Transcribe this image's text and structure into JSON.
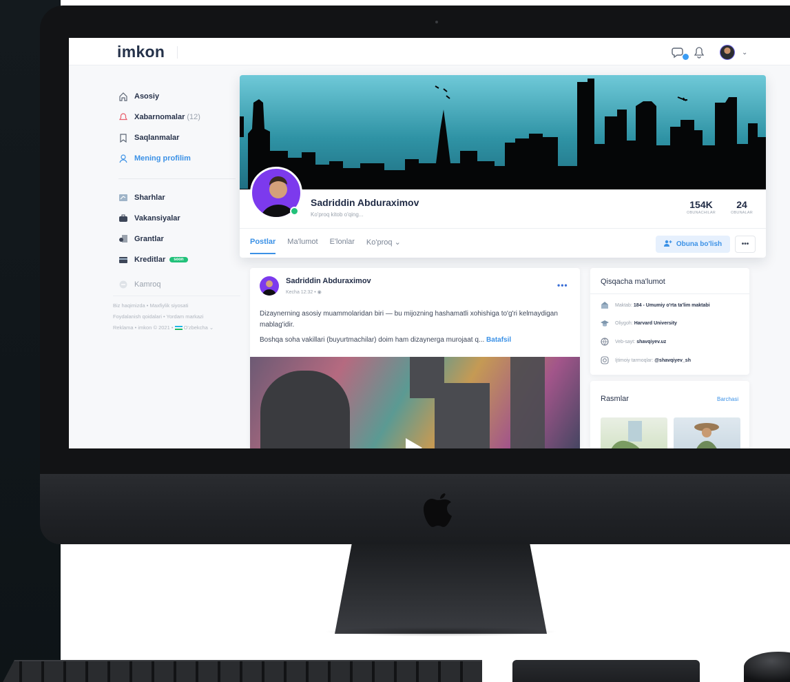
{
  "app": {
    "logo": "imkon"
  },
  "header": {
    "icons": [
      "chat-icon",
      "bell-icon",
      "avatar",
      "chevron-down-icon"
    ]
  },
  "sidebar": {
    "items": [
      {
        "label": "Asosiy",
        "icon": "home-icon"
      },
      {
        "label": "Xabarnomalar",
        "count": "(12)",
        "icon": "bell-icon"
      },
      {
        "label": "Saqlanmalar",
        "icon": "bookmark-icon"
      },
      {
        "label": "Mening profilim",
        "icon": "user-icon",
        "active": true
      },
      {
        "label": "Sharhlar",
        "icon": "review-icon"
      },
      {
        "label": "Vakansiyalar",
        "icon": "briefcase-icon"
      },
      {
        "label": "Grantlar",
        "icon": "grant-icon"
      },
      {
        "label": "Kreditlar",
        "badge": "soon",
        "icon": "card-icon"
      },
      {
        "label": "Kamroq",
        "icon": "minus-circle-icon"
      }
    ],
    "footer": {
      "line1": "Biz haqimizda • Maxfiylik siyosati",
      "line2": "Foydalanish qoidalari • Yordam markazi",
      "line3_left": "Reklama • imkon © 2021 •",
      "line3_lang": "O'zbekcha"
    }
  },
  "profile": {
    "name": "Sadriddin Abduraximov",
    "bio": "Ko'proq kitob o'qing...",
    "stats": [
      {
        "value": "154K",
        "label": "OBUNACHILAR"
      },
      {
        "value": "24",
        "label": "OBUNALAR"
      }
    ],
    "tabs": [
      "Postlar",
      "Ma'lumot",
      "E'lonlar",
      "Ko'proq"
    ],
    "follow_label": "Obuna bo'lish",
    "more_label": "•••"
  },
  "post": {
    "author": "Sadriddin Abduraximov",
    "time": "Kecha 12:32 •",
    "dots": "•••",
    "text1": "Dizaynerning asosiy muammolaridan biri — bu mijozning hashamatli xohishiga to'g'ri kelmaydigan mablag'idir.",
    "text2": "Boshqa soha vakillari (buyurtmachilar) doim ham dizaynerga murojaat q...",
    "more_link": "Batafsil"
  },
  "info": {
    "title": "Qisqacha ma'lumot",
    "rows": [
      {
        "label": "Maktab:",
        "value": "184 - Umumiy o'rta ta'lim maktabi",
        "icon": "school-icon"
      },
      {
        "label": "Oliygoh:",
        "value": "Harvard University",
        "icon": "graduation-icon"
      },
      {
        "label": "Veb-sayt:",
        "value": "shavqiyev.uz",
        "icon": "globe-icon"
      },
      {
        "label": "Ijtimoiy tarmoqlar:",
        "value": "@shavqiyev_sh",
        "icon": "instagram-icon"
      }
    ]
  },
  "gallery": {
    "title": "Rasmlar",
    "all_link": "Barchasi"
  },
  "colors": {
    "accent": "#3b91e6",
    "online": "#22c17a",
    "text_dark": "#1f2a44"
  }
}
